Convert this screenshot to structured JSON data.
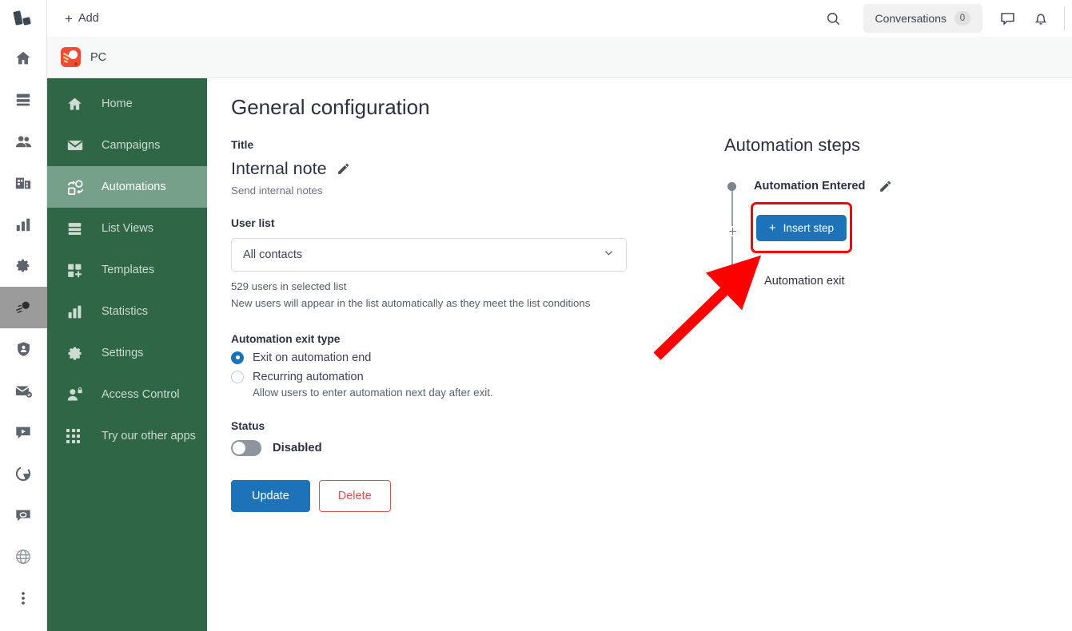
{
  "topbar": {
    "add_label": "Add",
    "search_icon": "search-icon",
    "conversations_label": "Conversations",
    "conversations_count": "0",
    "chat_icon": "chat-bubble-icon",
    "bell_icon": "bell-icon"
  },
  "breadcrumb": {
    "account_label": "PC",
    "logo_color": "#ef4c35"
  },
  "rail": {
    "logo_icon": "app-logo-icon",
    "items": [
      {
        "icon": "home-icon",
        "active": false
      },
      {
        "icon": "list-icon",
        "active": false
      },
      {
        "icon": "users-icon",
        "active": false
      },
      {
        "icon": "building-icon",
        "active": false
      },
      {
        "icon": "bar-chart-icon",
        "active": false
      },
      {
        "icon": "gear-icon",
        "active": false
      },
      {
        "icon": "comet-automation-icon",
        "active": true
      },
      {
        "icon": "shield-user-icon",
        "active": false
      },
      {
        "icon": "mail-check-icon",
        "active": false
      },
      {
        "icon": "video-icon",
        "active": false
      },
      {
        "icon": "pie-chart-icon",
        "active": false
      },
      {
        "icon": "speech-bubble-icon",
        "active": false
      },
      {
        "icon": "globe-icon",
        "active": false
      },
      {
        "icon": "more-vertical-icon",
        "active": false
      }
    ]
  },
  "sidebar": {
    "active_color": "#77a08a",
    "background_color": "#2e6646",
    "items": [
      {
        "label": "Home",
        "icon": "home-icon",
        "active": false
      },
      {
        "label": "Campaigns",
        "icon": "envelope-icon",
        "active": false
      },
      {
        "label": "Automations",
        "icon": "automation-flow-icon",
        "active": true
      },
      {
        "label": "List Views",
        "icon": "list-stack-icon",
        "active": false
      },
      {
        "label": "Templates",
        "icon": "template-plus-icon",
        "active": false
      },
      {
        "label": "Statistics",
        "icon": "bar-chart-icon",
        "active": false
      },
      {
        "label": "Settings",
        "icon": "gear-icon",
        "active": false
      },
      {
        "label": "Access Control",
        "icon": "user-lock-icon",
        "active": false
      },
      {
        "label": "Try our other apps",
        "icon": "apps-grid-icon",
        "active": false
      }
    ]
  },
  "main": {
    "page_title": "General configuration",
    "title_field": {
      "label": "Title",
      "value": "Internal note",
      "edit_icon": "pencil-icon",
      "hint": "Send internal notes"
    },
    "user_list": {
      "label": "User list",
      "selected": "All contacts",
      "caret_icon": "chevron-down-icon",
      "count_text": "529 users in selected list",
      "auto_text": "New users will appear in the list automatically as they meet the list conditions"
    },
    "exit_type": {
      "label": "Automation exit type",
      "options": [
        {
          "label": "Exit on automation end",
          "selected": true,
          "sub": ""
        },
        {
          "label": "Recurring automation",
          "selected": false,
          "sub": "Allow users to enter automation next day after exit."
        }
      ]
    },
    "status": {
      "label": "Status",
      "toggle_state": "off",
      "toggle_label": "Disabled"
    },
    "actions": {
      "update_label": "Update",
      "delete_label": "Delete",
      "primary_color": "#1d72b8",
      "danger_color": "#d9534f"
    }
  },
  "steps": {
    "title": "Automation steps",
    "entered_label": "Automation Entered",
    "entered_edit_icon": "pencil-icon",
    "plus_node_icon": "plus-icon",
    "insert_label": "Insert step",
    "insert_plus_icon": "plus-icon",
    "exit_label": "Automation exit",
    "exit_icon": "exit-arrow-icon",
    "highlight_color": "#ff0000"
  },
  "annotation": {
    "arrow_color": "#ff0000",
    "arrow_target": "insert-step-button"
  }
}
